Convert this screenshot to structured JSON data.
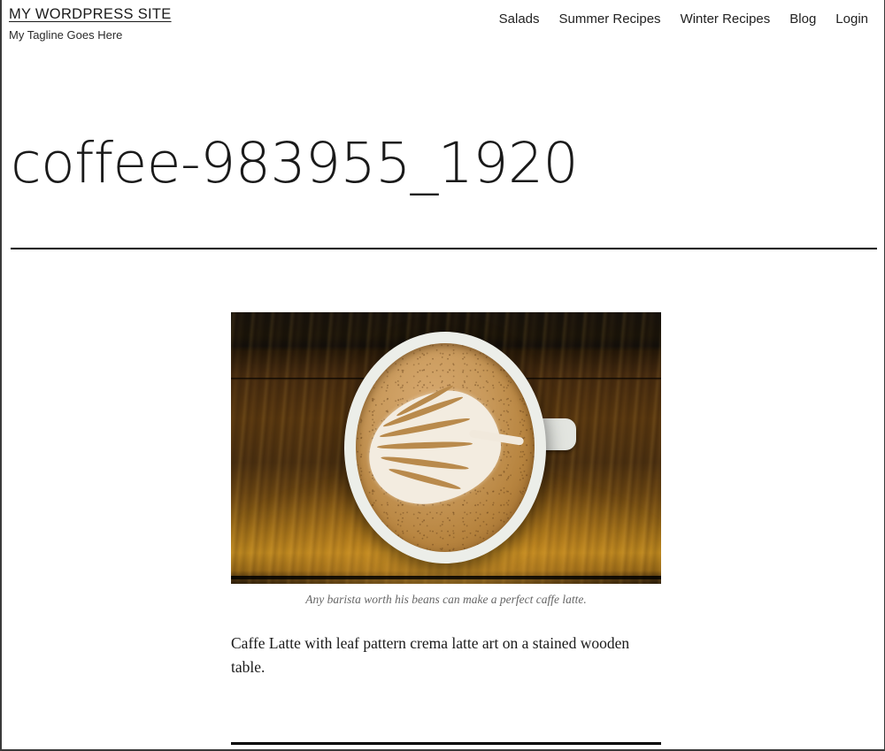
{
  "site": {
    "title": "MY WORDPRESS SITE",
    "tagline": "My Tagline Goes Here"
  },
  "nav": {
    "items": [
      {
        "label": "Salads"
      },
      {
        "label": "Summer Recipes"
      },
      {
        "label": "Winter Recipes"
      },
      {
        "label": "Blog"
      },
      {
        "label": "Login"
      }
    ]
  },
  "entry": {
    "title": "coffee-983955_1920",
    "caption": "Any barista worth his beans can make a perfect caffe latte.",
    "paragraph": "Caffe Latte with leaf pattern crema latte art on a stained wooden table.",
    "image_alt": "Overhead view of a caffe latte with leaf rosetta crema art in a white cup on a dark stained wooden table"
  },
  "colors": {
    "text": "#1a1a1a",
    "caption": "#666666",
    "rule": "#000000",
    "page_background": "#ffffff",
    "wood_dark": "#16110c",
    "wood_mid": "#57360f",
    "wood_light": "#b8851f",
    "crema": "#c99a5c",
    "cup_white": "#eceee9"
  }
}
